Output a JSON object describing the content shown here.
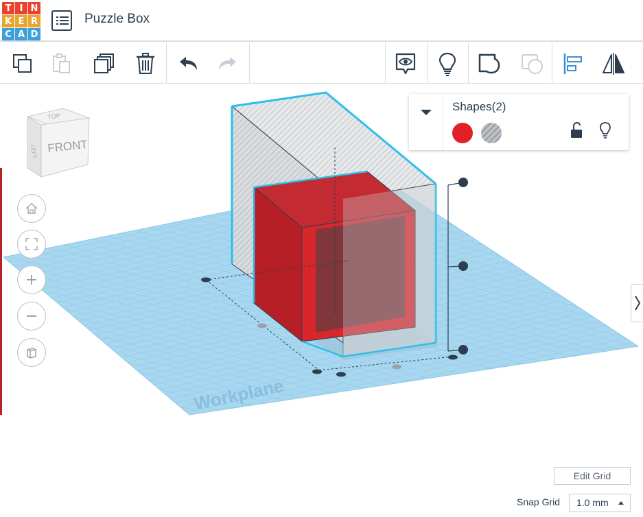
{
  "app": {
    "logo_letters": [
      "T",
      "I",
      "N",
      "K",
      "E",
      "R",
      "C",
      "A",
      "D"
    ],
    "logo_colors": [
      "#e8432f",
      "#e8432f",
      "#e8432f",
      "#e8a52f",
      "#e8a52f",
      "#e8a52f",
      "#3f9fd8",
      "#3f9fd8",
      "#3f9fd8"
    ],
    "title": "Puzzle Box"
  },
  "toolbar": {
    "items": [
      {
        "name": "copy-icon",
        "enabled": true
      },
      {
        "name": "paste-icon",
        "enabled": false
      },
      {
        "name": "duplicate-icon",
        "enabled": true
      },
      {
        "name": "delete-icon",
        "enabled": true
      },
      {
        "name": "undo-icon",
        "enabled": true
      },
      {
        "name": "redo-icon",
        "enabled": false
      },
      {
        "name": "notes-icon",
        "enabled": true
      },
      {
        "name": "lightbulb-icon",
        "enabled": true
      },
      {
        "name": "group-icon",
        "enabled": true
      },
      {
        "name": "ungroup-icon",
        "enabled": false
      },
      {
        "name": "align-icon",
        "enabled": true
      },
      {
        "name": "mirror-icon",
        "enabled": true
      }
    ]
  },
  "view_cube": {
    "face": "FRONT",
    "top": "TOP",
    "side": "LEFT"
  },
  "nav_controls": [
    "home-icon",
    "fit-icon",
    "zoom-in-icon",
    "zoom-out-icon",
    "perspective-icon"
  ],
  "shapes_panel": {
    "title": "Shapes(2)",
    "solid_color": "#e32027",
    "hole_pattern": "striped-gray",
    "icons": [
      "lock-icon",
      "lightbulb-icon"
    ]
  },
  "workplane": {
    "label": "Workplane",
    "color": "#a9d7ef",
    "grid_color": "#73bde4"
  },
  "edit_grid_label": "Edit Grid",
  "snap_grid": {
    "label": "Snap Grid",
    "value": "1.0 mm"
  }
}
